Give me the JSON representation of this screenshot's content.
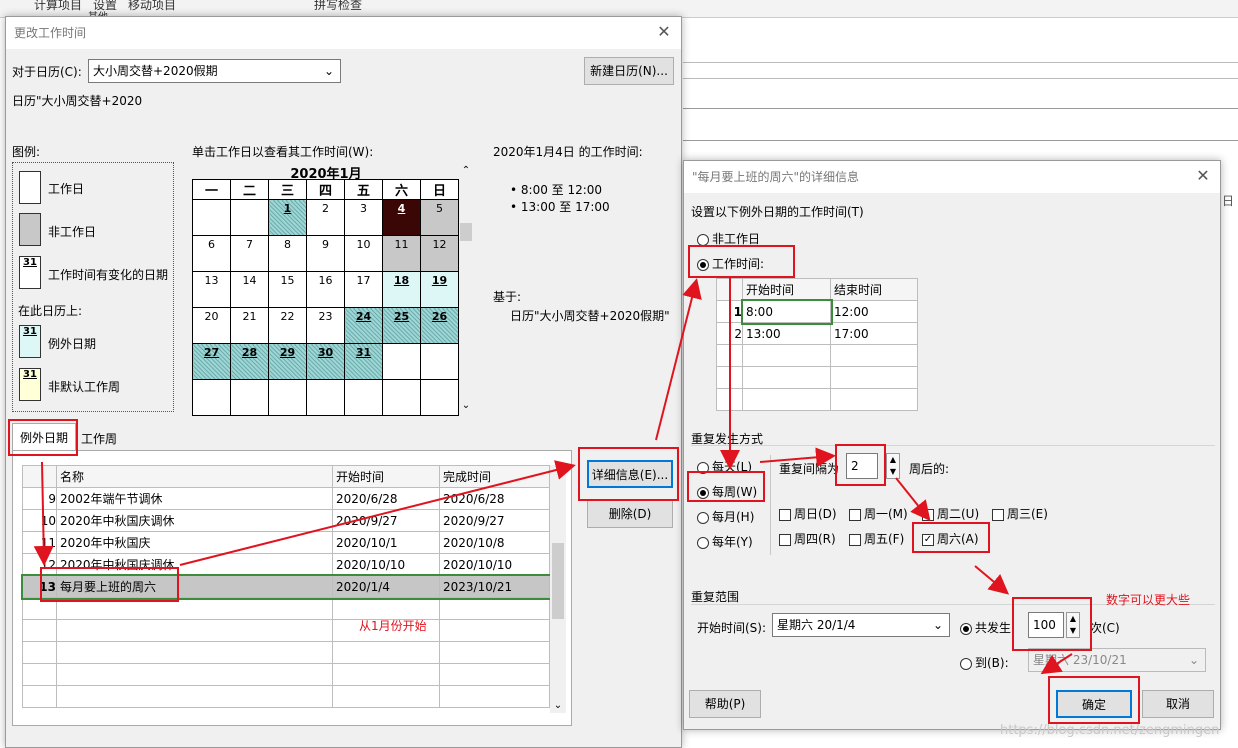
{
  "bg": {
    "m1": "计算项目",
    "m2": "设置",
    "m3": "移动项目",
    "m4": "其他",
    "spell": "拼写检查",
    "right_g": "日"
  },
  "d1": {
    "title": "更改工作时间",
    "for_cal_label": "对于日历(C):",
    "cal_select": "大小周交替+2020假期",
    "new_cal_btn": "新建日历(N)...",
    "cal_desc": "日历\"大小周交替+2020",
    "legend_title": "图例:",
    "legend": [
      "工作日",
      "非工作日",
      "工作时间有变化的日期",
      "例外日期",
      "非默认工作周"
    ],
    "legend_icon": "31",
    "on_this_cal": "在此日历上:",
    "click_hint": "单击工作日以查看其工作时间(W):",
    "month_title": "2020年1月",
    "weekdays": [
      "一",
      "二",
      "三",
      "四",
      "五",
      "六",
      "日"
    ],
    "weeks": [
      [
        "",
        "",
        "1",
        "2",
        "3",
        "4",
        "5"
      ],
      [
        "6",
        "7",
        "8",
        "9",
        "10",
        "11",
        "12"
      ],
      [
        "13",
        "14",
        "15",
        "16",
        "17",
        "18",
        "19"
      ],
      [
        "20",
        "21",
        "22",
        "23",
        "24",
        "25",
        "26"
      ],
      [
        "27",
        "28",
        "29",
        "30",
        "31",
        "",
        ""
      ],
      [
        "",
        "",
        "",
        "",
        "",
        "",
        ""
      ]
    ],
    "wt_title": "2020年1月4日 的工作时间:",
    "wt": [
      "• 8:00 至 12:00",
      "• 13:00 至 17:00"
    ],
    "based_on": "基于:",
    "based_cal": "日历\"大小周交替+2020假期\"",
    "tab_exc": "例外日期",
    "tab_week": "工作周",
    "detail_btn": "详细信息(E)...",
    "delete_btn": "删除(D)",
    "cols": [
      "名称",
      "开始时间",
      "完成时间"
    ],
    "rows": [
      {
        "id": "9",
        "name": "2002年端午节调休",
        "start": "2020/6/28",
        "end": "2020/6/28"
      },
      {
        "id": "10",
        "name": "2020年中秋国庆调休",
        "start": "2020/9/27",
        "end": "2020/9/27"
      },
      {
        "id": "11",
        "name": "2020年中秋国庆",
        "start": "2020/10/1",
        "end": "2020/10/8"
      },
      {
        "id": "12",
        "name": "2020年中秋国庆调休",
        "start": "2020/10/10",
        "end": "2020/10/10"
      },
      {
        "id": "13",
        "name": "每月要上班的周六",
        "start": "2020/1/4",
        "end": "2023/10/21"
      }
    ],
    "note": "从1月份开始"
  },
  "d2": {
    "title": "\"每月要上班的周六\"的详细信息",
    "section1": "设置以下例外日期的工作时间(T)",
    "opt_nonwork": "非工作日",
    "opt_work": "工作时间:",
    "cols": [
      "开始时间",
      "结束时间"
    ],
    "times": [
      {
        "n": "1",
        "s": "8:00",
        "e": "12:00"
      },
      {
        "n": "2",
        "s": "13:00",
        "e": "17:00"
      }
    ],
    "recur_title": "重复发生方式",
    "r_daily": "每天(L)",
    "r_weekly": "每周(W)",
    "r_monthly": "每月(H)",
    "r_yearly": "每年(Y)",
    "interval_label": "重复间隔为",
    "interval": "2",
    "after_weeks": "周后的:",
    "days": [
      [
        "周日(D)",
        "周一(M)",
        "周二(U)",
        "周三(E)"
      ],
      [
        "周四(R)",
        "周五(F)",
        "周六(A)"
      ]
    ],
    "range_title": "重复范围",
    "start_label": "开始时间(S):",
    "start_value": "星期六 20/1/4",
    "occur_label": "共发生",
    "occur_value": "100",
    "occur_suffix": "次(C)",
    "to_label": "到(B):",
    "to_value": "星期六 23/10/21",
    "help_btn": "帮助(P)",
    "ok_btn": "确定",
    "cancel_btn": "取消",
    "note": "数字可以更大些"
  },
  "watermark": "https://blog.csdn.net/zengmingen"
}
